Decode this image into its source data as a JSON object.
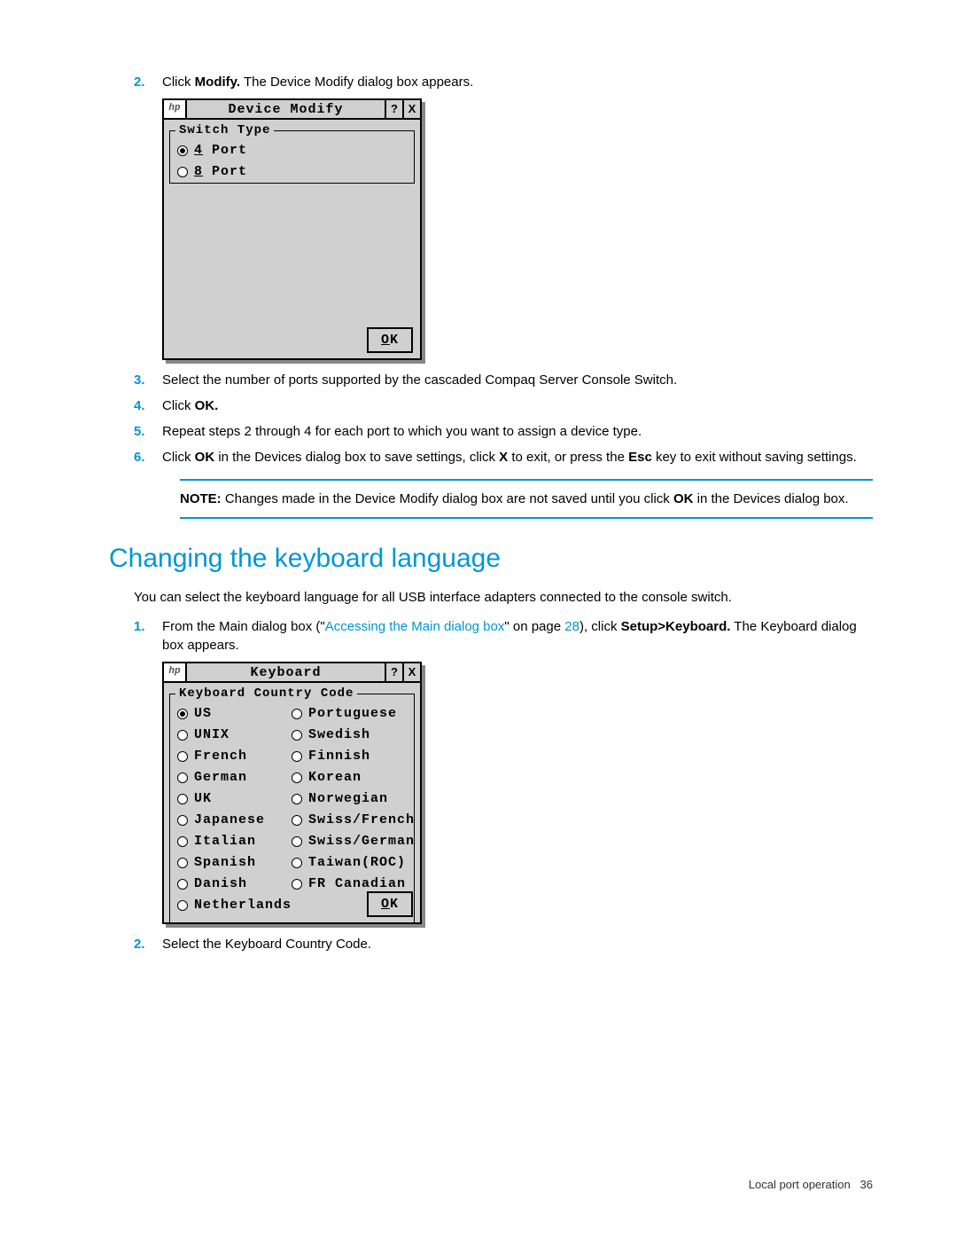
{
  "steps_top": {
    "s2": {
      "num": "2.",
      "pre": "Click ",
      "bold": "Modify.",
      "post": " The Device Modify dialog box appears."
    },
    "s3": {
      "num": "3.",
      "text": "Select the number of ports supported by the cascaded Compaq Server Console Switch."
    },
    "s4": {
      "num": "4.",
      "pre": "Click ",
      "bold": "OK."
    },
    "s5": {
      "num": "5.",
      "text": "Repeat steps 2 through 4 for each port to which you want to assign a device type."
    },
    "s6": {
      "num": "6.",
      "pre": "Click ",
      "b1": "OK",
      "mid1": " in the Devices dialog box to save settings, click ",
      "b2": "X",
      "mid2": " to exit, or press the ",
      "b3": "Esc",
      "post": " key to exit without saving settings."
    }
  },
  "dialog1": {
    "title": "Device Modify",
    "help": "?",
    "close": "X",
    "legend": "Switch Type",
    "opt1_hk": "4",
    "opt1_rest": " Port",
    "opt2_hk": "8",
    "opt2_rest": " Port",
    "ok_hk": "O",
    "ok_rest": "K"
  },
  "note": {
    "label": "NOTE:",
    "pre": "  Changes made in the Device Modify dialog box are not saved until you click ",
    "bold": "OK",
    "post": " in the Devices dialog box."
  },
  "section_heading": "Changing the keyboard language",
  "intro": "You can select the keyboard language for all USB interface adapters connected to the console switch.",
  "steps_bottom": {
    "s1": {
      "num": "1.",
      "pre": "From the Main dialog box (\"",
      "link": "Accessing the Main dialog box",
      "mid": "\" on page ",
      "page": "28",
      "post1": "), click ",
      "bold": "Setup>Keyboard.",
      "post2": " The Keyboard dialog box appears."
    },
    "s2": {
      "num": "2.",
      "text": "Select the Keyboard Country Code."
    }
  },
  "dialog2": {
    "title": "Keyboard",
    "help": "?",
    "close": "X",
    "legend": "Keyboard Country Code",
    "left": [
      "US",
      "UNIX",
      "French",
      "German",
      "UK",
      "Japanese",
      "Italian",
      "Spanish",
      "Danish",
      "Netherlands"
    ],
    "right": [
      "Portuguese",
      "Swedish",
      "Finnish",
      "Korean",
      "Norwegian",
      "Swiss/French",
      "Swiss/German",
      "Taiwan(ROC)",
      "FR Canadian"
    ],
    "selected": "US",
    "ok_hk": "O",
    "ok_rest": "K"
  },
  "footer": {
    "label": "Local port operation",
    "page": "36"
  }
}
